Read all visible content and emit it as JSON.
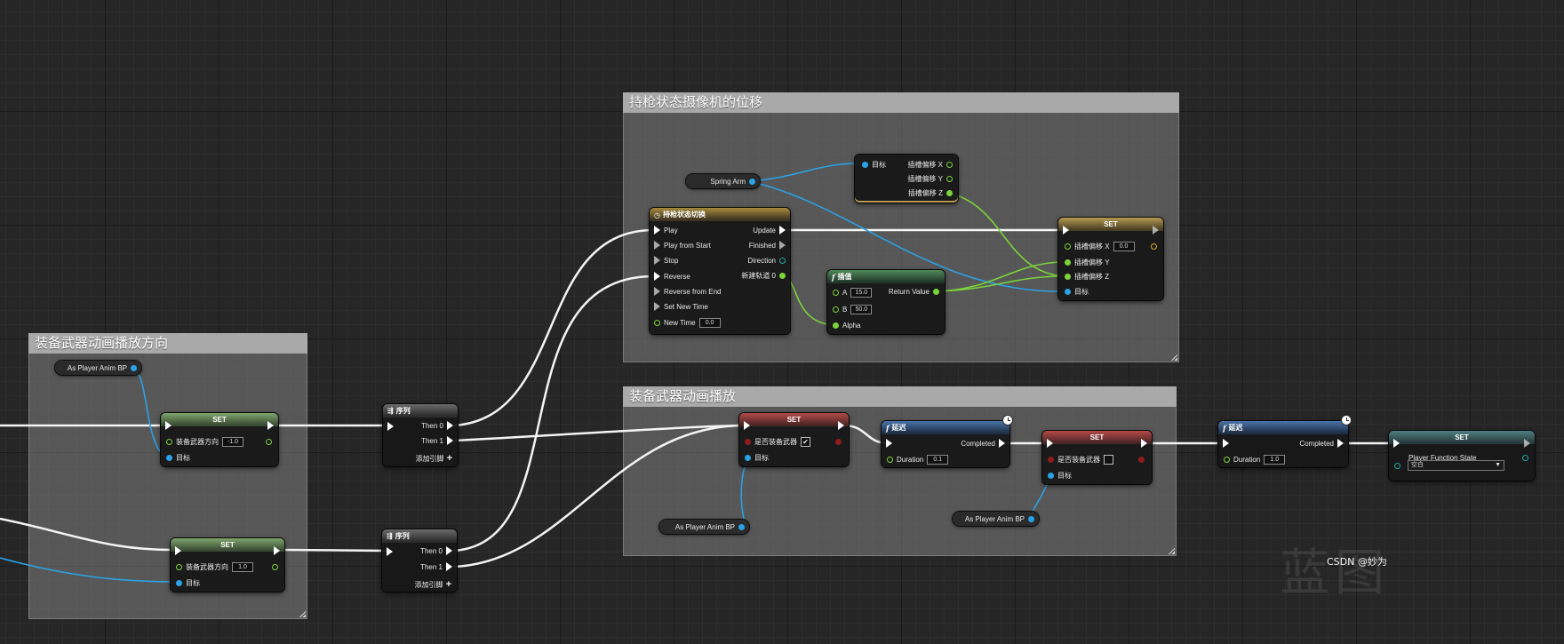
{
  "comments": {
    "camera": {
      "title": "持枪状态摄像机的位移"
    },
    "equip_dir": {
      "title": "装备武器动画播放方向"
    },
    "equip_play": {
      "title": "装备武器动画播放"
    }
  },
  "vars": {
    "spring_arm": "Spring Arm",
    "anim_bp_1": "As Player Anim BP",
    "anim_bp_2": "As Player Anim BP",
    "anim_bp_3": "As Player Anim BP"
  },
  "break_node": {
    "target": "目标",
    "x": "插槽偏移 X",
    "y": "插槽偏移 Y",
    "z": "插槽偏移 Z"
  },
  "timeline": {
    "title": "持枪状态切换",
    "play": "Play",
    "play_from_start": "Play from Start",
    "stop": "Stop",
    "reverse": "Reverse",
    "reverse_from_end": "Reverse from End",
    "set_new_time": "Set New Time",
    "new_time": "New Time",
    "new_time_value": "0.0",
    "update": "Update",
    "finished": "Finished",
    "direction": "Direction",
    "track": "新建轨道 0"
  },
  "lerp": {
    "title": "插值",
    "a": "A",
    "a_value": "15.0",
    "b": "B",
    "b_value": "50.0",
    "alpha": "Alpha",
    "return_value": "Return Value"
  },
  "set_offset": {
    "title": "SET",
    "x": "插槽偏移 X",
    "x_value": "0.0",
    "y": "插槽偏移 Y",
    "z": "插槽偏移 Z",
    "target": "目标"
  },
  "set_dir_1": {
    "title": "SET",
    "label": "装备武器方向",
    "value": "-1.0",
    "target": "目标"
  },
  "set_dir_2": {
    "title": "SET",
    "label": "装备武器方向",
    "value": "1.0",
    "target": "目标"
  },
  "seq_1": {
    "title": "序列",
    "then0": "Then 0",
    "then1": "Then 1",
    "add_pin": "添加引脚"
  },
  "seq_2": {
    "title": "序列",
    "then0": "Then 0",
    "then1": "Then 1",
    "add_pin": "添加引脚"
  },
  "set_equip_1": {
    "title": "SET",
    "label": "是否装备武器",
    "checked": "✔",
    "target": "目标"
  },
  "delay_1": {
    "title": "延迟",
    "completed": "Completed",
    "duration": "Duration",
    "duration_value": "0.1"
  },
  "set_equip_2": {
    "title": "SET",
    "label": "是否装备武器",
    "checked": "",
    "target": "目标"
  },
  "delay_2": {
    "title": "延迟",
    "completed": "Completed",
    "duration": "Duration",
    "duration_value": "1.0"
  },
  "set_state": {
    "title": "SET",
    "label": "Player Function State",
    "value": "空白"
  },
  "watermark": "CSDN @妙为",
  "bg_glyph": "蓝图",
  "colors": {
    "exec": "#ffffff",
    "float": "#7bd33a",
    "object": "#2aa2e6",
    "bool": "#8e1c1c",
    "enum": "#24a6a0",
    "vector": "#d9a627"
  }
}
